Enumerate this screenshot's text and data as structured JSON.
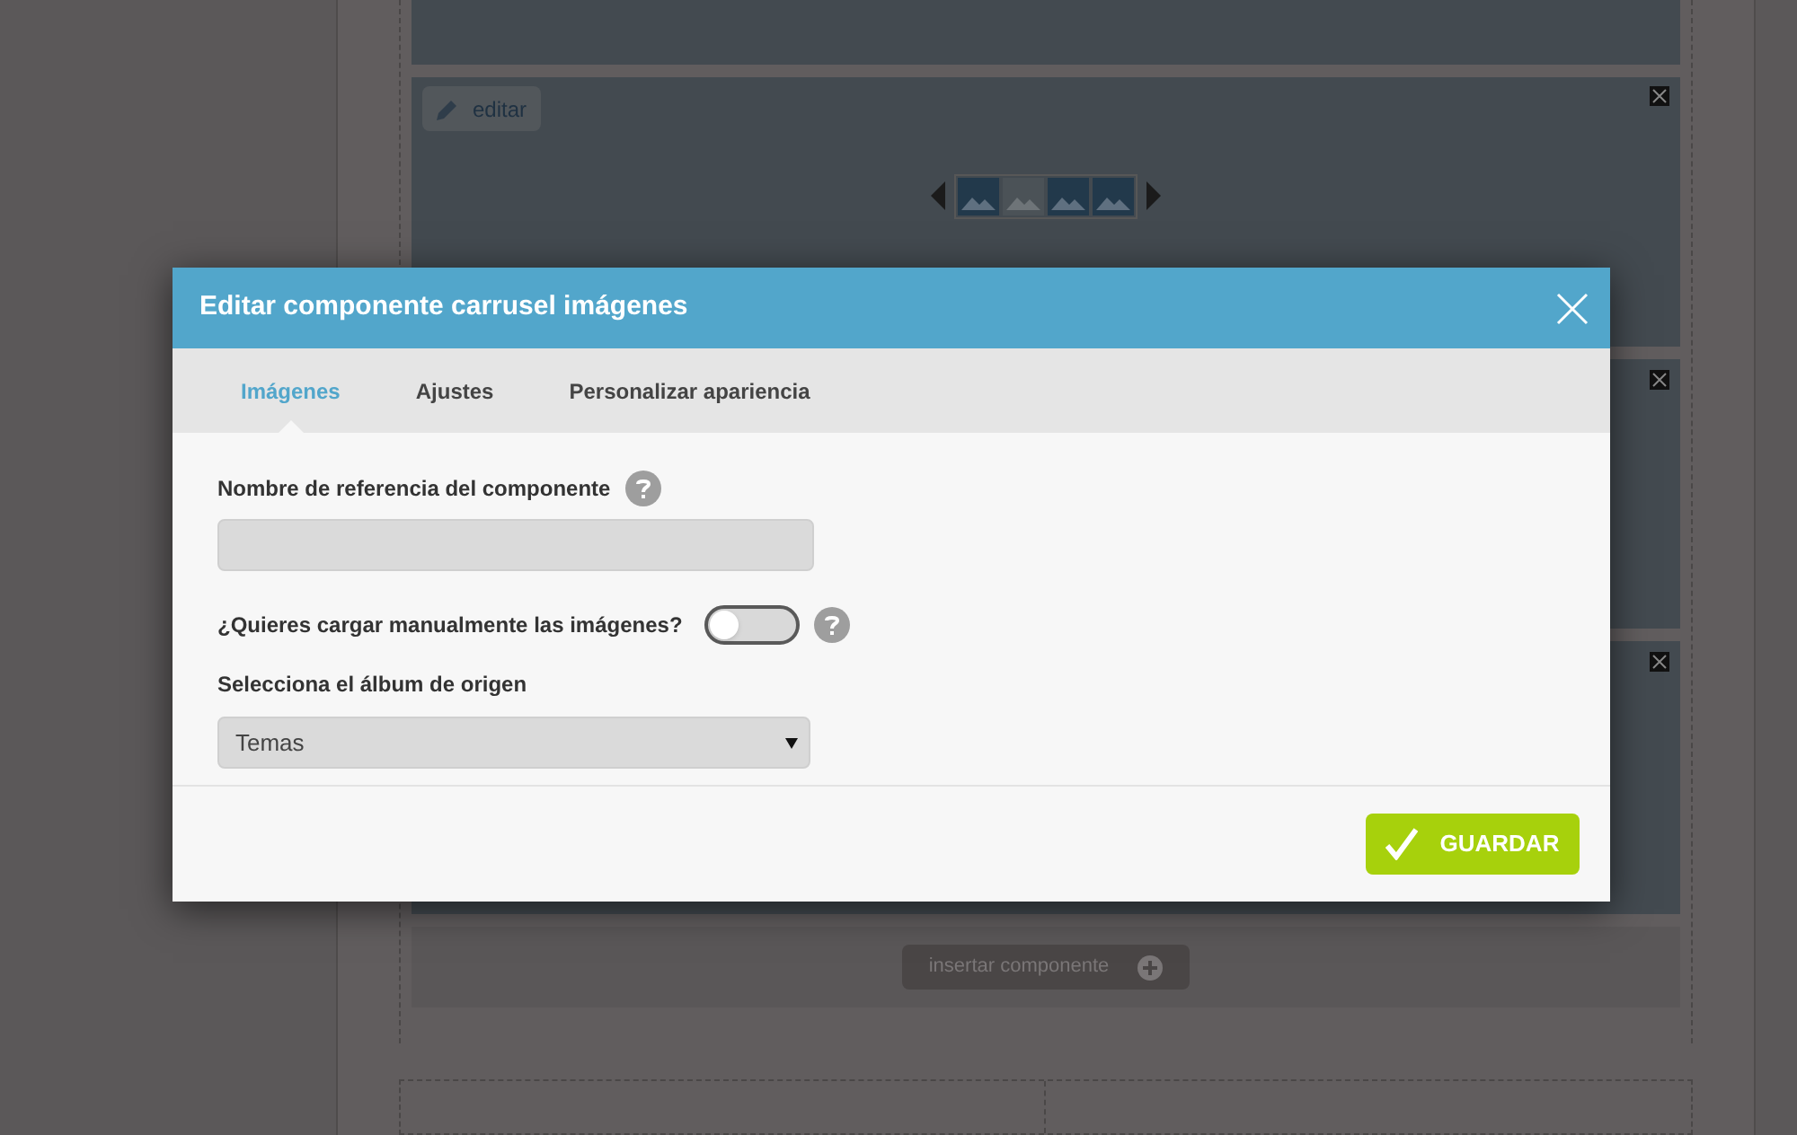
{
  "page": {
    "edit_button": "editar",
    "carousel_slides": [
      {
        "selected": false
      },
      {
        "selected": true
      },
      {
        "selected": false
      },
      {
        "selected": false
      }
    ],
    "insert_button": "insertar componente"
  },
  "dialog": {
    "title": "Editar componente carrusel imágenes",
    "tabs": [
      {
        "label": "Imágenes",
        "selected": true
      },
      {
        "label": "Ajustes",
        "selected": false
      },
      {
        "label": "Personalizar apariencia",
        "selected": false
      }
    ],
    "reference_name": {
      "label": "Nombre de referencia del componente"
    },
    "manual_upload": {
      "label": "¿Quieres cargar manualmente las imágenes?",
      "on": false
    },
    "album": {
      "label": "Selecciona el álbum de origen",
      "value": "Temas"
    },
    "save_button": "GUARDAR"
  }
}
